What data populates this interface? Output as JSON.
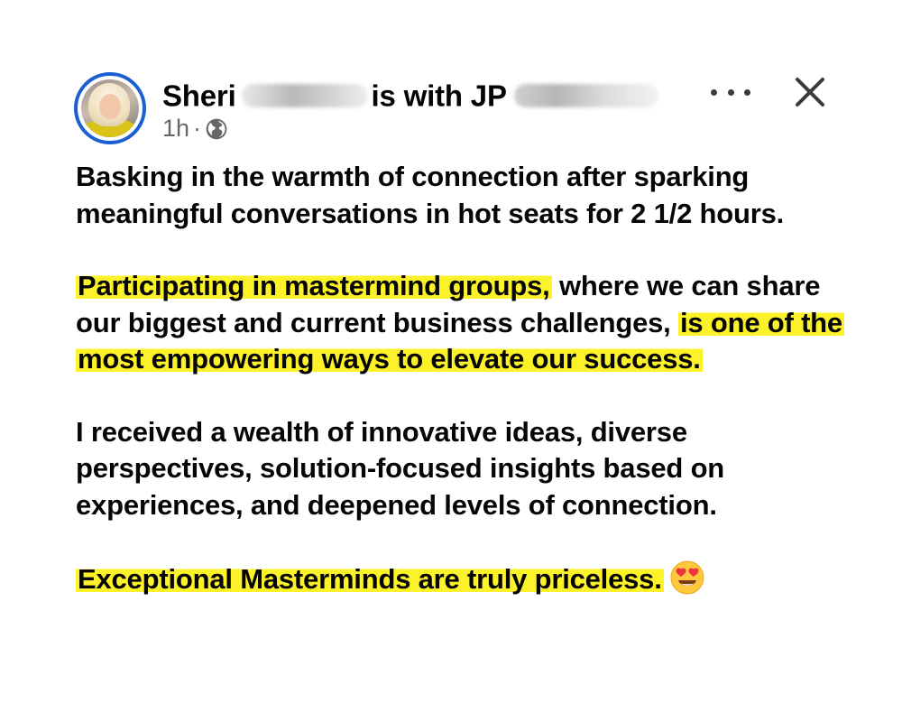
{
  "post": {
    "author": "Sheri",
    "with_text": "is with",
    "tagged": "JP",
    "time": "1h",
    "separator": "·",
    "audience_icon": "globe-icon",
    "more_icon": "more-options-icon",
    "close_icon": "close-icon",
    "paragraphs": [
      "Basking in the warmth of connection after sparking meaningful conversations in hot seats for 2 1/2 hours.",
      "Participating in mastermind groups,",
      "where we can share our biggest and current business challenges,",
      "is one of the most empowering ways to elevate our success.",
      "I received a wealth of innovative ideas, diverse perspectives, solution-focused insights based on experiences, and deepened levels of connection.",
      "Exceptional Masterminds are truly priceless."
    ],
    "emoji": "heart-eyes-emoji"
  },
  "colors": {
    "highlight": "#fbf22a",
    "avatar_ring": "#1b5fd1",
    "text": "#050505",
    "meta": "#65676b"
  }
}
